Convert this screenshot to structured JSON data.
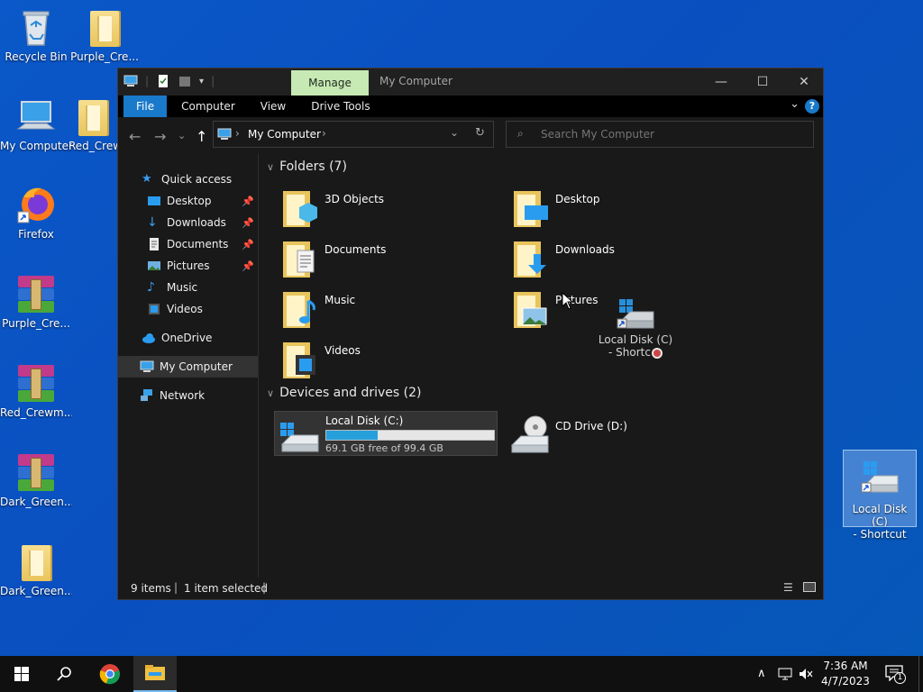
{
  "desktop": {
    "icons": [
      {
        "label": "Recycle Bin",
        "icon": "recycle-bin-icon"
      },
      {
        "label": "Purple_Cre...",
        "icon": "folder-icon"
      },
      {
        "label": "My Computer",
        "icon": "computer-icon"
      },
      {
        "label": "Red_Crew",
        "icon": "folder-icon"
      },
      {
        "label": "Firefox",
        "icon": "firefox-icon"
      },
      {
        "label": "Purple_Cre...",
        "icon": "archive-icon"
      },
      {
        "label": "Red_Crewm...",
        "icon": "archive-icon"
      },
      {
        "label": "Dark_Green...",
        "icon": "archive-icon"
      },
      {
        "label": "Dark_Green...",
        "icon": "folder-icon"
      },
      {
        "label": "Local Disk (C)\n- Shortcut",
        "icon": "drive-shortcut-icon"
      }
    ]
  },
  "window": {
    "title": "My Computer",
    "contextual_tab": "Manage",
    "ribbon_tabs": [
      "File",
      "Computer",
      "View",
      "Drive Tools"
    ],
    "address": {
      "location": "My Computer"
    },
    "search": {
      "placeholder": "Search My Computer"
    }
  },
  "sidebar": {
    "items": [
      {
        "label": "Quick access",
        "icon": "star-icon",
        "pinned": false
      },
      {
        "label": "Desktop",
        "icon": "desktop-icon",
        "pinned": true
      },
      {
        "label": "Downloads",
        "icon": "download-icon",
        "pinned": true
      },
      {
        "label": "Documents",
        "icon": "document-icon",
        "pinned": true
      },
      {
        "label": "Pictures",
        "icon": "pictures-icon",
        "pinned": true
      },
      {
        "label": "Music",
        "icon": "music-icon",
        "pinned": false
      },
      {
        "label": "Videos",
        "icon": "videos-icon",
        "pinned": false
      },
      {
        "label": "OneDrive",
        "icon": "cloud-icon",
        "pinned": false
      },
      {
        "label": "My Computer",
        "icon": "computer-icon",
        "pinned": false,
        "selected": true
      },
      {
        "label": "Network",
        "icon": "network-icon",
        "pinned": false
      }
    ]
  },
  "content": {
    "folders_header": "Folders (7)",
    "folders": [
      {
        "name": "3D Objects",
        "icon": "3d-objects-folder-icon"
      },
      {
        "name": "Desktop",
        "icon": "desktop-folder-icon"
      },
      {
        "name": "Documents",
        "icon": "documents-folder-icon"
      },
      {
        "name": "Downloads",
        "icon": "downloads-folder-icon"
      },
      {
        "name": "Music",
        "icon": "music-folder-icon"
      },
      {
        "name": "Pictures",
        "icon": "pictures-folder-icon"
      },
      {
        "name": "Videos",
        "icon": "videos-folder-icon"
      }
    ],
    "drives_header": "Devices and drives (2)",
    "drives": [
      {
        "name": "Local Disk (C:)",
        "free_text": "69.1 GB free of 99.4 GB",
        "used_fraction": 0.305,
        "selected": true
      },
      {
        "name": "CD Drive (D:)"
      }
    ],
    "drag_ghost": {
      "label_line1": "Local Disk (C)",
      "label_line2": "- Shortc"
    }
  },
  "statusbar": {
    "items_count": "9 items",
    "selection": "1 item selected"
  },
  "taskbar": {
    "time": "7:36 AM",
    "date": "4/7/2023",
    "notification_count": "1"
  },
  "colors": {
    "desktop_bg": "#0a4fbf",
    "window_bg": "#191919",
    "ribbon_file": "#1979ca",
    "manage_tab": "#c7e9b4",
    "drive_bar_fill": "#26a0da"
  }
}
